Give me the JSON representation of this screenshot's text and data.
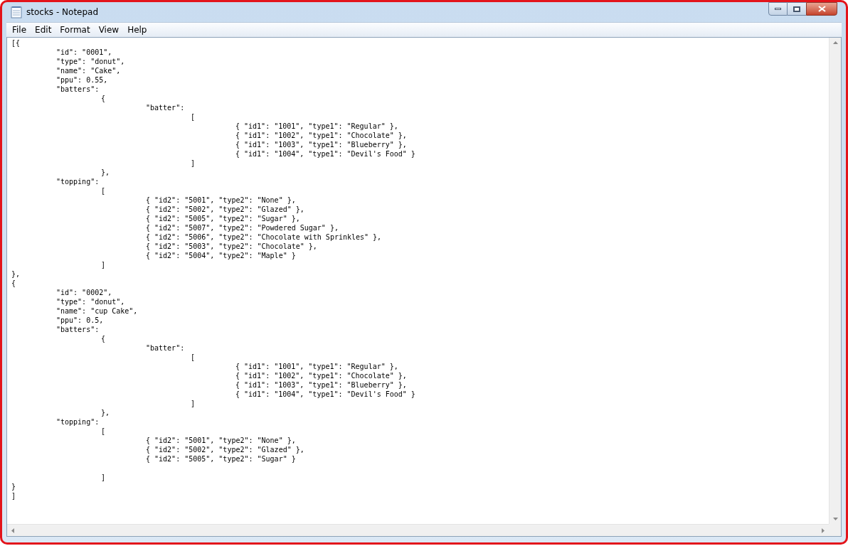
{
  "window": {
    "title": "stocks - Notepad"
  },
  "menu": [
    {
      "label": "File"
    },
    {
      "label": "Edit"
    },
    {
      "label": "Format"
    },
    {
      "label": "View"
    },
    {
      "label": "Help"
    }
  ],
  "document": {
    "lines": [
      "[{",
      "\t\"id\": \"0001\",",
      "\t\"type\": \"donut\",",
      "\t\"name\": \"Cake\",",
      "\t\"ppu\": 0.55,",
      "\t\"batters\":",
      "\t\t{",
      "\t\t\t\"batter\":",
      "\t\t\t\t[",
      "\t\t\t\t\t{ \"id1\": \"1001\", \"type1\": \"Regular\" },",
      "\t\t\t\t\t{ \"id1\": \"1002\", \"type1\": \"Chocolate\" },",
      "\t\t\t\t\t{ \"id1\": \"1003\", \"type1\": \"Blueberry\" },",
      "\t\t\t\t\t{ \"id1\": \"1004\", \"type1\": \"Devil's Food\" }",
      "\t\t\t\t]",
      "\t\t},",
      "\t\"topping\":",
      "\t\t[",
      "\t\t\t{ \"id2\": \"5001\", \"type2\": \"None\" },",
      "\t\t\t{ \"id2\": \"5002\", \"type2\": \"Glazed\" },",
      "\t\t\t{ \"id2\": \"5005\", \"type2\": \"Sugar\" },",
      "\t\t\t{ \"id2\": \"5007\", \"type2\": \"Powdered Sugar\" },",
      "\t\t\t{ \"id2\": \"5006\", \"type2\": \"Chocolate with Sprinkles\" },",
      "\t\t\t{ \"id2\": \"5003\", \"type2\": \"Chocolate\" },",
      "\t\t\t{ \"id2\": \"5004\", \"type2\": \"Maple\" }",
      "\t\t]",
      "},",
      "{",
      "\t\"id\": \"0002\",",
      "\t\"type\": \"donut\",",
      "\t\"name\": \"cup Cake\",",
      "\t\"ppu\": 0.5,",
      "\t\"batters\":",
      "\t\t{",
      "\t\t\t\"batter\":",
      "\t\t\t\t[",
      "\t\t\t\t\t{ \"id1\": \"1001\", \"type1\": \"Regular\" },",
      "\t\t\t\t\t{ \"id1\": \"1002\", \"type1\": \"Chocolate\" },",
      "\t\t\t\t\t{ \"id1\": \"1003\", \"type1\": \"Blueberry\" },",
      "\t\t\t\t\t{ \"id1\": \"1004\", \"type1\": \"Devil's Food\" }",
      "\t\t\t\t]",
      "\t\t},",
      "\t\"topping\":",
      "\t\t[",
      "\t\t\t{ \"id2\": \"5001\", \"type2\": \"None\" },",
      "\t\t\t{ \"id2\": \"5002\", \"type2\": \"Glazed\" },",
      "\t\t\t{ \"id2\": \"5005\", \"type2\": \"Sugar\" }\n",
      "\t\t]",
      "}",
      "]"
    ]
  }
}
